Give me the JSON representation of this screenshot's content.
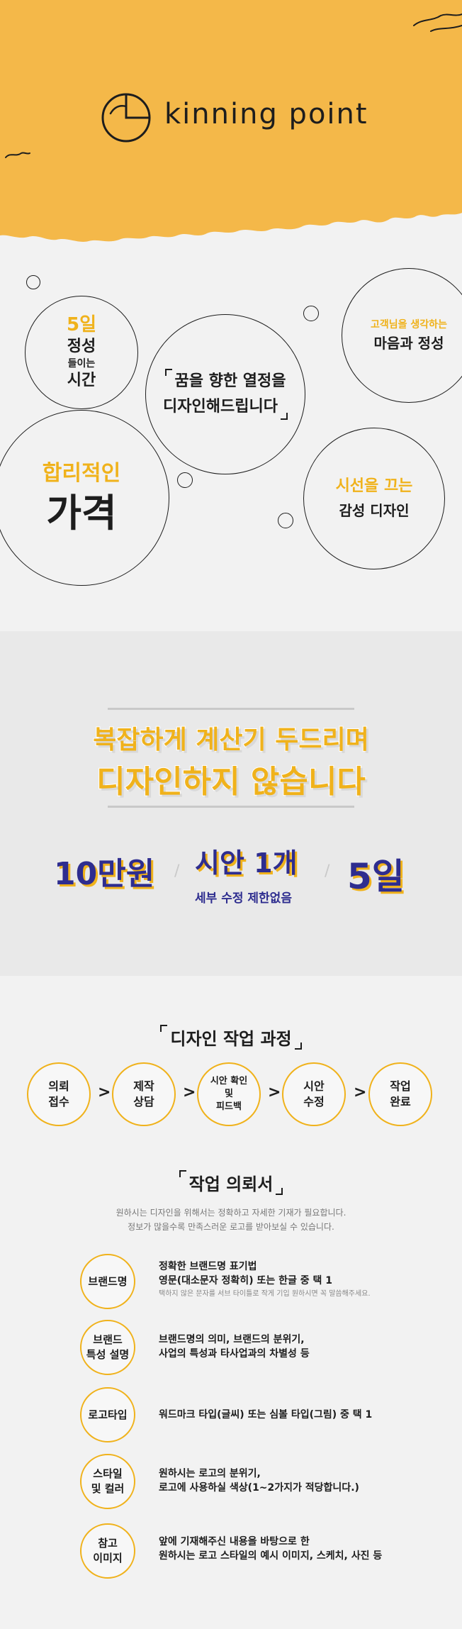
{
  "header": {
    "logo_text": "kinning point",
    "colors": {
      "yellow": "#f4b849",
      "ink": "#1d1d1d"
    }
  },
  "features": {
    "c1": {
      "highlight": "5일",
      "line1": "정성",
      "line2": "들이는",
      "line3": "시간"
    },
    "c2": {
      "line1": "꿈을 향한 열정을",
      "line2": "디자인해드립니다"
    },
    "c3": {
      "highlight": "고객님을 생각하는",
      "line1": "마음과 정성"
    },
    "c4": {
      "highlight": "합리적인",
      "line1": "가격"
    },
    "c5": {
      "highlight": "시선을 끄는",
      "line1": "감성 디자인"
    }
  },
  "banner": {
    "line1": "복잡하게 계산기 두드리며",
    "line2": "디자인하지 않습니다",
    "price": "10만원",
    "drafts": "시안 1개",
    "drafts_sub": "세부 수정 제한없음",
    "days": "5일",
    "colors": {
      "navy": "#2e2d8f",
      "yellow": "#f0b21b"
    }
  },
  "process": {
    "title": "디자인 작업 과정",
    "steps": [
      {
        "lines": [
          "의뢰",
          "접수"
        ]
      },
      {
        "lines": [
          "제작",
          "상담"
        ]
      },
      {
        "lines": [
          "시안 확인",
          "및",
          "피드백"
        ]
      },
      {
        "lines": [
          "시안",
          "수정"
        ]
      },
      {
        "lines": [
          "작업",
          "완료"
        ]
      }
    ],
    "arrow": ">"
  },
  "request": {
    "title": "작업 의뢰서",
    "desc1": "원하시는 디자인을 위해서는 정확하고 자세한 기재가 필요합니다.",
    "desc2": "정보가 많을수록 만족스러운 로고를 받아보실 수 있습니다.",
    "items": [
      {
        "label": [
          "브랜드명"
        ],
        "text": [
          "정확한 브랜드명 표기법",
          "영문(대소문자 정확히) 또는 한글 중 택 1"
        ],
        "note": "택하지 않은 문자를 서브 타이틀로 작게 기입 원하시면 꼭 말씀해주세요."
      },
      {
        "label": [
          "브랜드",
          "특성 설명"
        ],
        "text": [
          "브랜드명의 의미, 브랜드의 분위기,",
          "사업의 특성과 타사업과의 차별성 등"
        ]
      },
      {
        "label": [
          "로고타입"
        ],
        "text": [
          "워드마크 타입(글씨) 또는 심볼 타입(그림) 중 택 1"
        ]
      },
      {
        "label": [
          "스타일",
          "및 컬러"
        ],
        "text": [
          "원하시는 로고의 분위기,",
          "로고에 사용하실 색상(1~2가지가 적당합니다.)"
        ]
      },
      {
        "label": [
          "참고",
          "이미지"
        ],
        "text": [
          "앞에 기재해주신 내용을 바탕으로 한",
          "원하시는 로고 스타일의 예시 이미지, 스케치, 사진 등"
        ]
      }
    ]
  }
}
